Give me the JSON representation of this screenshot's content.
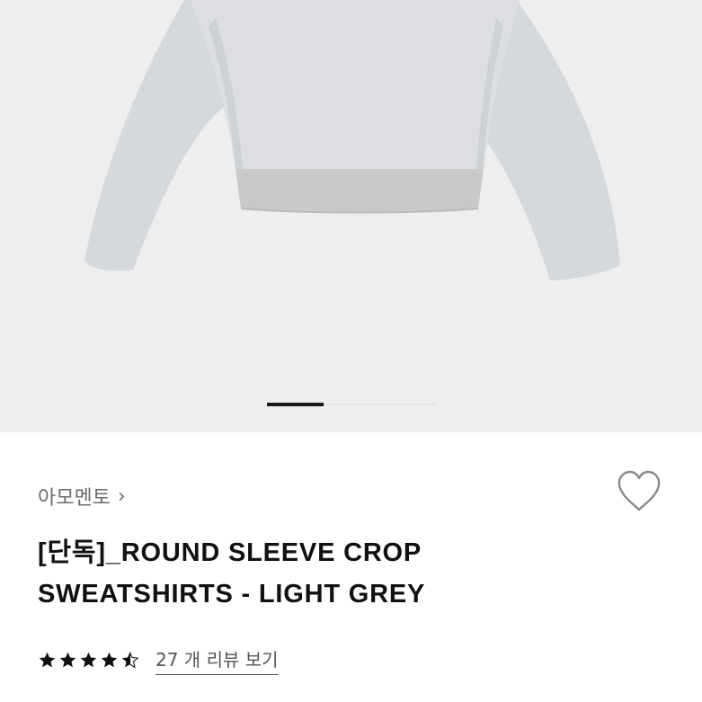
{
  "product": {
    "brand": "아모멘토",
    "brand_chevron": "›",
    "title_line1": "[단독]_ROUND SLEEVE CROP",
    "title_line2": "SWEATSHIRTS - LIGHT GREY",
    "rating_stars": 4.5,
    "review_link": "27 개 리뷰 보기"
  },
  "gallery": {
    "current_index": 1,
    "image_description_icon": "sweatshirt-image"
  },
  "icons": {
    "wishlist": "heart-outline-icon",
    "star": "star-icon"
  },
  "colors": {
    "star": "#111111",
    "hero_bg": "#eeeeee",
    "garment": "#d8dadd",
    "rib": "#c9cbc9"
  }
}
